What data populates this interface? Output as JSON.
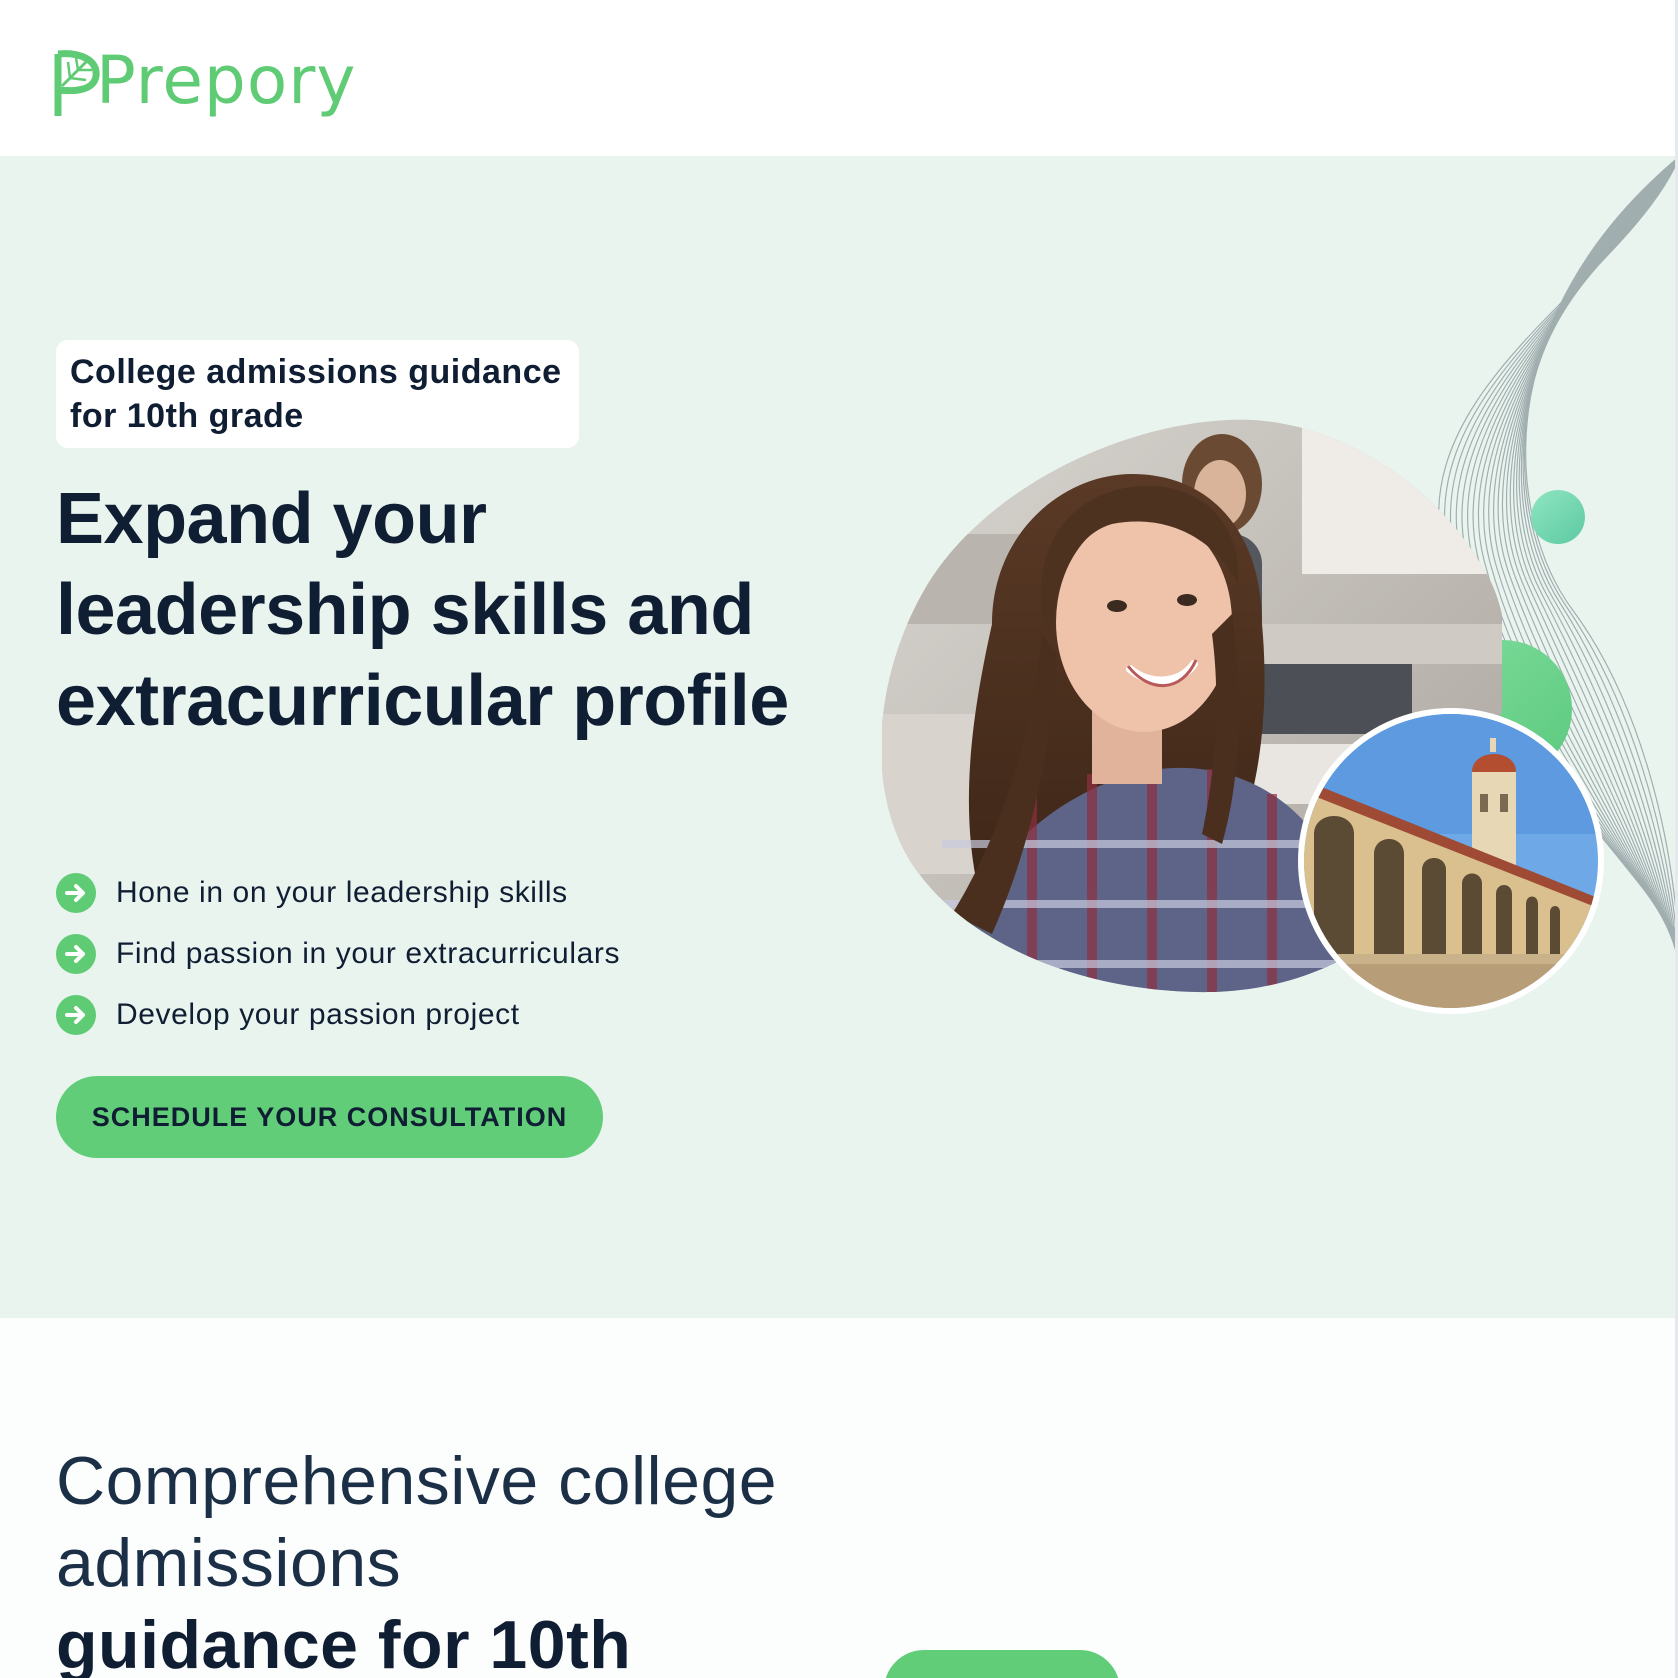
{
  "brand": {
    "name": "Prepory",
    "accent_color": "#5fcb74",
    "logo_icon": "leaf-icon"
  },
  "hero": {
    "badge": "College admissions guidance for 10th grade",
    "title": "Expand your leadership skills and extracurricular profile",
    "features": [
      {
        "icon": "arrow-right-circle-icon",
        "text": "Hone in on your leadership skills"
      },
      {
        "icon": "arrow-right-circle-icon",
        "text": "Find passion in your extracurriculars"
      },
      {
        "icon": "arrow-right-circle-icon",
        "text": "Develop your passion project"
      }
    ],
    "cta_label": "SCHEDULE YOUR CONSULTATION",
    "background_color": "#eaf4ef"
  },
  "section2": {
    "title_light": "Comprehensive college admissions",
    "title_bold": "guidance for 10th"
  }
}
